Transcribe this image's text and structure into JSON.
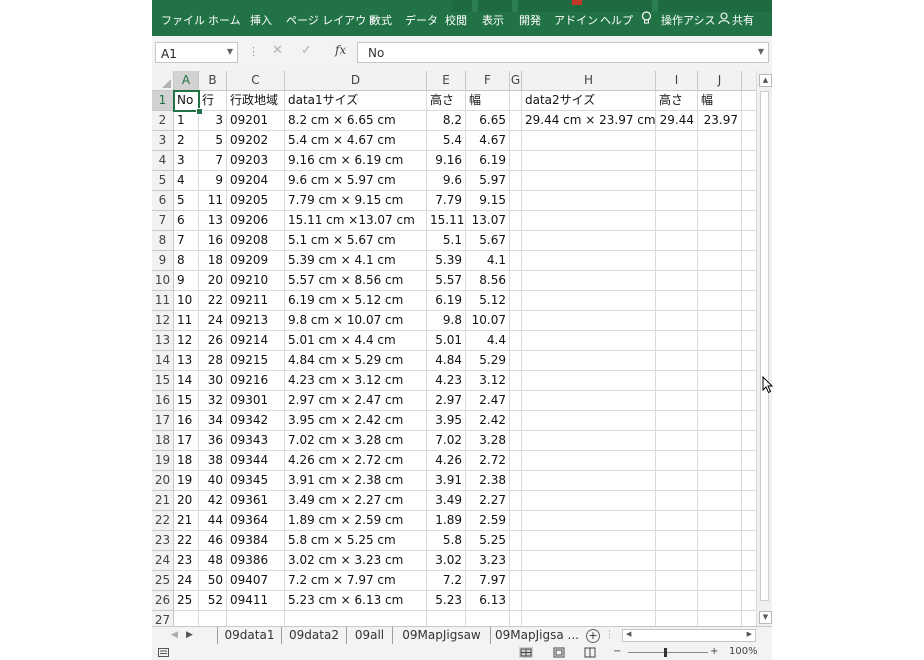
{
  "ribbon": {
    "tabs": [
      "ファイル",
      "ホーム",
      "挿入",
      "ページ レイアウト",
      "数式",
      "データ",
      "校閲",
      "表示",
      "開発",
      "アドイン",
      "ヘルプ"
    ],
    "tell_me_label": "操作アシス",
    "share_label": "共有"
  },
  "name_box": {
    "value": "A1"
  },
  "formula_bar": {
    "value": "No",
    "fx_label": "fx"
  },
  "columns": [
    "A",
    "B",
    "C",
    "D",
    "E",
    "F",
    "G",
    "H",
    "I",
    "J"
  ],
  "header_row": {
    "A": "No",
    "B": "行",
    "C": "行政地域",
    "D": "data1サイズ",
    "E": "高さ",
    "F": "幅",
    "G": "",
    "H": "data2サイズ",
    "I": "高さ",
    "J": "幅"
  },
  "data2_row": {
    "H": "29.44 cm × 23.97 cm",
    "I": "29.44",
    "J": "23.97"
  },
  "rows": [
    [
      "1",
      "3",
      "09201",
      "8.2 cm × 6.65 cm",
      "8.2",
      "6.65"
    ],
    [
      "2",
      "5",
      "09202",
      "5.4 cm × 4.67 cm",
      "5.4",
      "4.67"
    ],
    [
      "3",
      "7",
      "09203",
      "9.16 cm × 6.19 cm",
      "9.16",
      "6.19"
    ],
    [
      "4",
      "9",
      "09204",
      "9.6 cm × 5.97 cm",
      "9.6",
      "5.97"
    ],
    [
      "5",
      "11",
      "09205",
      "7.79 cm × 9.15 cm",
      "7.79",
      "9.15"
    ],
    [
      "6",
      "13",
      "09206",
      "15.11 cm ×13.07  cm",
      "15.11",
      "13.07"
    ],
    [
      "7",
      "16",
      "09208",
      "5.1 cm × 5.67 cm",
      "5.1",
      "5.67"
    ],
    [
      "8",
      "18",
      "09209",
      "5.39 cm × 4.1 cm",
      "5.39",
      "4.1"
    ],
    [
      "9",
      "20",
      "09210",
      "5.57 cm × 8.56 cm",
      "5.57",
      "8.56"
    ],
    [
      "10",
      "22",
      "09211",
      "6.19 cm × 5.12 cm",
      "6.19",
      "5.12"
    ],
    [
      "11",
      "24",
      "09213",
      "9.8 cm × 10.07 cm",
      "9.8",
      "10.07"
    ],
    [
      "12",
      "26",
      "09214",
      "5.01 cm × 4.4 cm",
      "5.01",
      "4.4"
    ],
    [
      "13",
      "28",
      "09215",
      "4.84 cm × 5.29 cm",
      "4.84",
      "5.29"
    ],
    [
      "14",
      "30",
      "09216",
      "4.23 cm × 3.12 cm",
      "4.23",
      "3.12"
    ],
    [
      "15",
      "32",
      "09301",
      "2.97 cm × 2.47 cm",
      "2.97",
      "2.47"
    ],
    [
      "16",
      "34",
      "09342",
      "3.95 cm × 2.42 cm",
      "3.95",
      "2.42"
    ],
    [
      "17",
      "36",
      "09343",
      "7.02 cm × 3.28 cm",
      "7.02",
      "3.28"
    ],
    [
      "18",
      "38",
      "09344",
      "4.26 cm × 2.72 cm",
      "4.26",
      "2.72"
    ],
    [
      "19",
      "40",
      "09345",
      "3.91 cm × 2.38 cm",
      "3.91",
      "2.38"
    ],
    [
      "20",
      "42",
      "09361",
      "3.49 cm × 2.27 cm",
      "3.49",
      "2.27"
    ],
    [
      "21",
      "44",
      "09364",
      "1.89 cm × 2.59 cm",
      "1.89",
      "2.59"
    ],
    [
      "22",
      "46",
      "09384",
      "5.8 cm × 5.25 cm",
      "5.8",
      "5.25"
    ],
    [
      "23",
      "48",
      "09386",
      "3.02 cm × 3.23 cm",
      "3.02",
      "3.23"
    ],
    [
      "24",
      "50",
      "09407",
      "7.2 cm × 7.97 cm",
      "7.2",
      "7.97"
    ],
    [
      "25",
      "52",
      "09411",
      "5.23 cm × 6.13 cm",
      "5.23",
      "6.13"
    ]
  ],
  "row_numbers": [
    "1",
    "2",
    "3",
    "4",
    "5",
    "6",
    "7",
    "8",
    "9",
    "10",
    "11",
    "12",
    "13",
    "14",
    "15",
    "16",
    "17",
    "18",
    "19",
    "20",
    "21",
    "22",
    "23",
    "24",
    "25",
    "26",
    "27"
  ],
  "sheet_tabs": [
    "09data1",
    "09data2",
    "09all",
    "09MapJigsaw",
    "09MapJigsa ..."
  ],
  "status": {
    "zoom": "100%"
  },
  "colors": {
    "ribbon": "#217346",
    "selection": "#217346"
  }
}
